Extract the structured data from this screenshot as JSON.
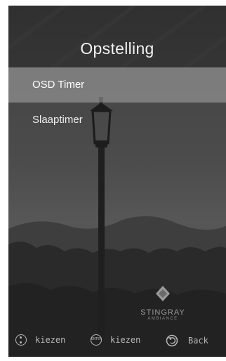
{
  "screen": {
    "title": "Opstelling",
    "menu": [
      {
        "label": "OSD Timer",
        "selected": true
      },
      {
        "label": "Slaaptimer",
        "selected": false
      }
    ]
  },
  "branding": {
    "logo_text": "STINGRAY",
    "logo_sub": "AMBIANCE",
    "logo_icon": "stingray-diamond-icon"
  },
  "footer": {
    "navigate_label": "kiezen",
    "navigate_icon": "navigate-up-down-icon",
    "select_label": "kiezen",
    "select_icon": "enter-button-icon",
    "select_icon_text": "ENTER",
    "back_label": "Back",
    "back_icon": "back-arrow-icon"
  },
  "colors": {
    "selected_row": "#9e9e9e",
    "text": "#eeeeee",
    "hint_text": "#b8b8b8"
  }
}
